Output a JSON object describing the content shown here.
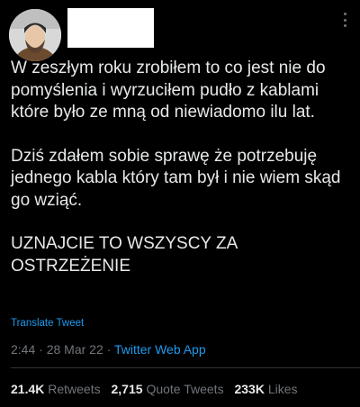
{
  "tweet": {
    "paragraphs": [
      "W zeszłym roku zrobiłem to co jest nie do pomyślenia i wyrzuciłem pudło z kablami które było ze mną od niewiadomo ilu lat.",
      "Dziś zdałem sobie sprawę że potrzebuję jednego kabla który tam był i nie wiem skąd go wziąć.",
      "UZNAJCIE TO WSZYSCY ZA OSTRZEŻENIE"
    ],
    "translate_label": "Translate Tweet",
    "time": "2:44",
    "separator": "·",
    "date": "28 Mar 22",
    "app": "Twitter Web App"
  },
  "stats": {
    "retweets_count": "21.4K",
    "retweets_label": "Retweets",
    "quotes_count": "2,715",
    "quotes_label": "Quote Tweets",
    "likes_count": "233K",
    "likes_label": "Likes"
  },
  "colors": {
    "background": "#000000",
    "text": "#e7e9ea",
    "muted": "#71767b",
    "accent": "#1d9bf0",
    "divider": "#2f3336"
  },
  "icons": {
    "more": "more-vertical-icon"
  }
}
